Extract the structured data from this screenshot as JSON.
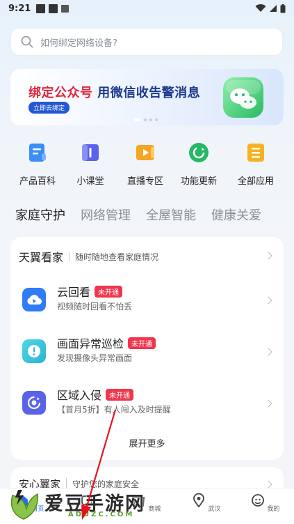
{
  "status": {
    "time": "9:21"
  },
  "search": {
    "placeholder": "如何绑定网络设备?"
  },
  "banner": {
    "title_red": "绑定公众号",
    "title_rest": " 用微信收告警消息",
    "cta": "立即去绑定"
  },
  "grid": [
    {
      "label": "产品百科",
      "icon": "book-icon",
      "color": "#3a8ef6"
    },
    {
      "label": "小课堂",
      "icon": "class-icon",
      "color": "#5a63e8"
    },
    {
      "label": "直播专区",
      "icon": "live-icon",
      "color": "#f5a623"
    },
    {
      "label": "功能更新",
      "icon": "refresh-icon",
      "color": "#25b866"
    },
    {
      "label": "全部应用",
      "icon": "apps-icon",
      "color": "#f5b323"
    }
  ],
  "tabs": [
    "家庭守护",
    "网络管理",
    "全屋智能",
    "健康关爱"
  ],
  "card1": {
    "title": "天翼看家",
    "subtitle": "随时随地查看家庭情况",
    "rows": [
      {
        "title": "云回看",
        "badge": "未开通",
        "sub": "视频随时回看不怕丢",
        "icon": "cloud-play-icon",
        "color": "#2f7cf6"
      },
      {
        "title": "画面异常巡检",
        "badge": "未开通",
        "sub": "发现摄像头异常画面",
        "icon": "alert-icon",
        "color": "#2bbfd6"
      },
      {
        "title": "区域入侵",
        "badge": "未开通",
        "sub": "【首月5折】有人闯入及时提醒",
        "icon": "target-icon",
        "color": "#5a63e8"
      }
    ],
    "more": "展开更多"
  },
  "card2": {
    "title": "安心翼家",
    "subtitle": "守护您的家庭安全"
  },
  "tabbar": [
    {
      "label": "首页",
      "icon": "home-icon"
    },
    {
      "label": "",
      "icon": "device-icon"
    },
    {
      "label": "商城",
      "icon": "shop-icon"
    },
    {
      "label": "武汉",
      "icon": "location-icon"
    },
    {
      "label": "我的",
      "icon": "profile-icon"
    }
  ],
  "watermark": {
    "big": "爱豆手游网",
    "small": "ADUZC.COM"
  }
}
